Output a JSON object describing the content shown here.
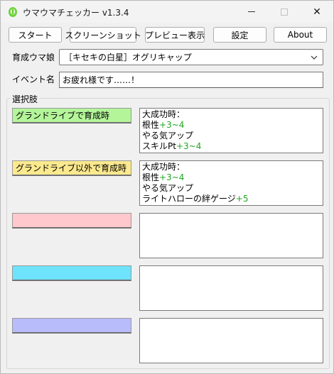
{
  "window": {
    "title": "ウマウマチェッカー v1.3.4",
    "close_glyph": "✕"
  },
  "toolbar": {
    "start_label": "スタート",
    "screenshot_label": "スクリーンショット",
    "preview_label": "プレビュー表示",
    "settings_label": "設定",
    "about_label": "About"
  },
  "form": {
    "uma_label": "育成ウマ娘",
    "uma_value": "［キセキの白星］オグリキャップ",
    "event_label": "イベント名",
    "event_value": "お疲れ様です……！"
  },
  "choices": {
    "group_title": "選択肢",
    "items": [
      {
        "label": "グランドライブで育成時",
        "color": "#b4f59a",
        "result": [
          {
            "text": "大成功時：",
            "plus": ""
          },
          {
            "text": "根性",
            "plus": "+3~4"
          },
          {
            "text": "やる気アップ",
            "plus": ""
          },
          {
            "text": "スキルPt",
            "plus": "+3~4"
          }
        ]
      },
      {
        "label": "グランドライブ以外で育成時",
        "color": "#fbe98e",
        "result": [
          {
            "text": "大成功時：",
            "plus": ""
          },
          {
            "text": "根性",
            "plus": "+3~4"
          },
          {
            "text": "やる気アップ",
            "plus": ""
          },
          {
            "text": "ライトハローの絆ゲージ",
            "plus": "+5"
          }
        ]
      },
      {
        "label": "",
        "color": "#ffc8cc",
        "result": []
      },
      {
        "label": "",
        "color": "#6fe3fb",
        "result": []
      },
      {
        "label": "",
        "color": "#b8bcfb",
        "result": []
      }
    ]
  }
}
